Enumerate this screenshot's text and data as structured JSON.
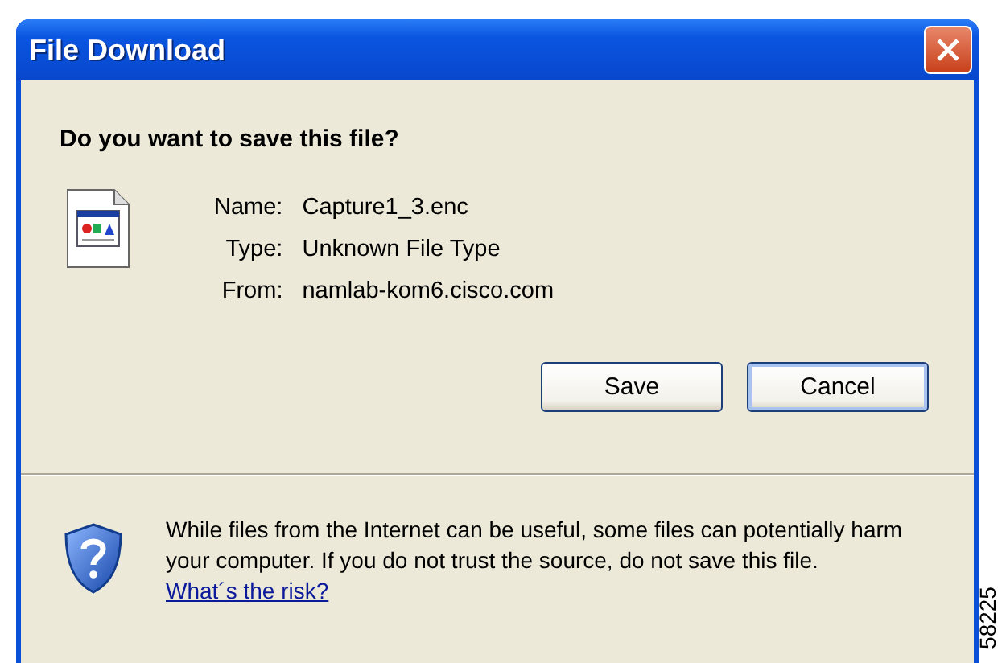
{
  "window": {
    "title": "File Download"
  },
  "question": "Do you want to save this file?",
  "fields": [
    {
      "label": "Name:",
      "value": "Capture1_3.enc"
    },
    {
      "label": "Type:",
      "value": "Unknown File Type"
    },
    {
      "label": "From:",
      "value": "namlab-kom6.cisco.com"
    }
  ],
  "buttons": [
    {
      "label": "Save",
      "default": false
    },
    {
      "label": "Cancel",
      "default": true
    }
  ],
  "warning": {
    "text": "While files from the Internet can be useful, some files can potentially harm your computer. If you do not trust the source, do not save this file.",
    "link": "What´s the risk?"
  },
  "figure_number": "58225"
}
